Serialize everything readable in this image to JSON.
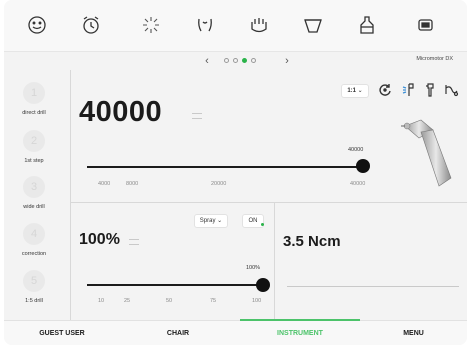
{
  "top_icons": [
    "smiley-icon",
    "alarm-clock-icon",
    "light-icon",
    "tooth-icon",
    "gum-icon",
    "cup-icon",
    "bowl-icon",
    "battery-icon"
  ],
  "pager": {
    "prev": "‹",
    "next": "›",
    "page_count": 4,
    "active_page": 3
  },
  "device_name": "Micromotor DX",
  "steps": [
    {
      "number": "1",
      "label": "direct drill"
    },
    {
      "number": "2",
      "label": "1st step"
    },
    {
      "number": "3",
      "label": "wide drill"
    },
    {
      "number": "4",
      "label": "correction"
    },
    {
      "number": "5",
      "label": "1:5 drill"
    }
  ],
  "speed": {
    "ratio": "1:1",
    "ratio_caret": "⌄",
    "value": "40000",
    "slider_label": "40000",
    "slider_level": 1.0,
    "ticks": [
      "4000",
      "8000",
      "20000",
      "40000"
    ],
    "icons": [
      "rotation-direction-icon",
      "spray-light-icon",
      "handpiece-icon",
      "water-icon"
    ]
  },
  "spray": {
    "mode": "Spray",
    "mode_caret": "⌄",
    "toggle": "ON",
    "value": "100%",
    "slider_label": "100%",
    "slider_level": 1.0,
    "ticks": [
      "10",
      "25",
      "50",
      "75",
      "100"
    ]
  },
  "torque": {
    "value": "3.5 Ncm"
  },
  "nav": {
    "items": [
      "GUEST USER",
      "CHAIR",
      "INSTRUMENT",
      "MENU"
    ],
    "active_index": 2
  },
  "colors": {
    "accent": "#4cc36a",
    "active_dot": "#2bb34a",
    "background": "#f3f3f3"
  }
}
